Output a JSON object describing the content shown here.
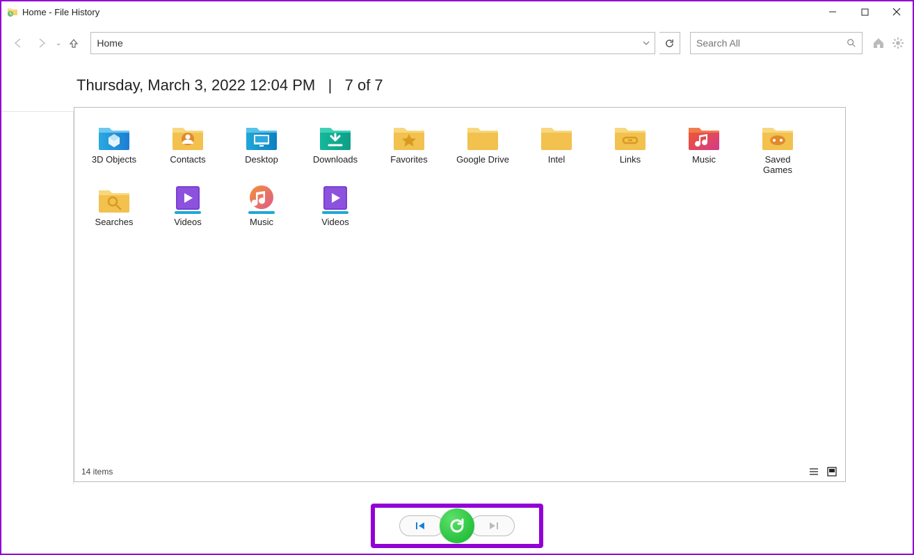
{
  "window": {
    "title": "Home - File History"
  },
  "toolbar": {
    "address_value": "Home",
    "search_placeholder": "Search All"
  },
  "header": {
    "datetime": "Thursday, March 3, 2022 12:04 PM",
    "separator": "|",
    "position": "7 of 7"
  },
  "items": [
    {
      "label": "3D Objects",
      "icon": "folder-3d"
    },
    {
      "label": "Contacts",
      "icon": "folder-contacts"
    },
    {
      "label": "Desktop",
      "icon": "folder-desktop"
    },
    {
      "label": "Downloads",
      "icon": "folder-downloads"
    },
    {
      "label": "Favorites",
      "icon": "folder-favorites"
    },
    {
      "label": "Google Drive",
      "icon": "folder-plain"
    },
    {
      "label": "Intel",
      "icon": "folder-plain"
    },
    {
      "label": "Links",
      "icon": "folder-links"
    },
    {
      "label": "Music",
      "icon": "folder-music-red"
    },
    {
      "label": "Saved Games",
      "icon": "folder-games"
    },
    {
      "label": "Searches",
      "icon": "folder-search"
    },
    {
      "label": "Videos",
      "icon": "library-videos"
    },
    {
      "label": "Music",
      "icon": "library-music"
    },
    {
      "label": "Videos",
      "icon": "library-videos"
    }
  ],
  "status": {
    "count_text": "14 items"
  }
}
